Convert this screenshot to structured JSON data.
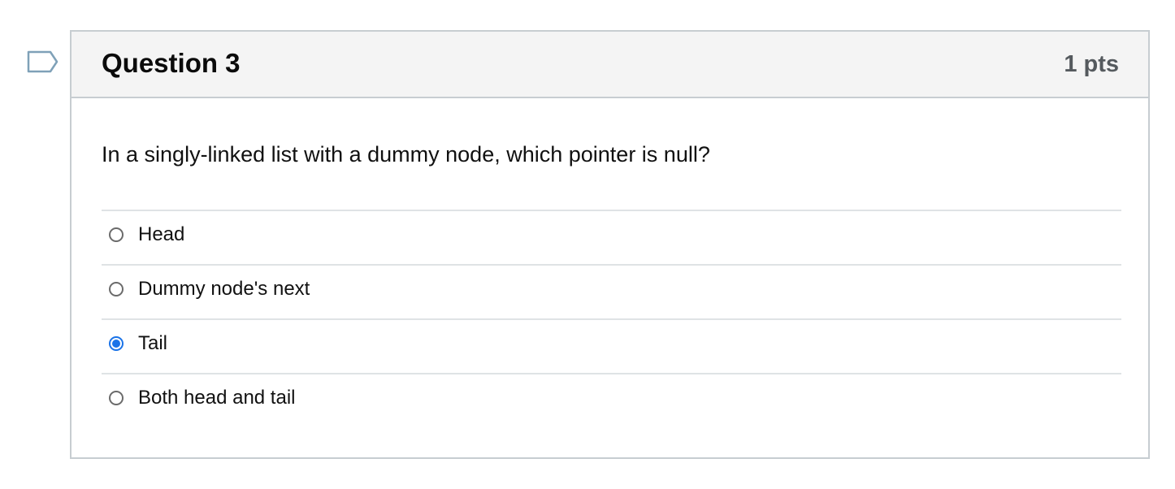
{
  "question": {
    "title": "Question 3",
    "points": "1 pts",
    "text": "In a singly-linked list with a dummy node, which pointer is null?",
    "flag_icon": "flag-outline-icon",
    "answers": [
      {
        "label": "Head",
        "selected": false
      },
      {
        "label": "Dummy node's next",
        "selected": false
      },
      {
        "label": "Tail",
        "selected": true
      },
      {
        "label": "Both head and tail",
        "selected": false
      }
    ],
    "selected_answer": "Tail"
  },
  "colors": {
    "accent": "#1a73e8",
    "header_bg": "#f4f4f4",
    "border": "#c7cdd1",
    "flag": "#7fa1b8"
  }
}
